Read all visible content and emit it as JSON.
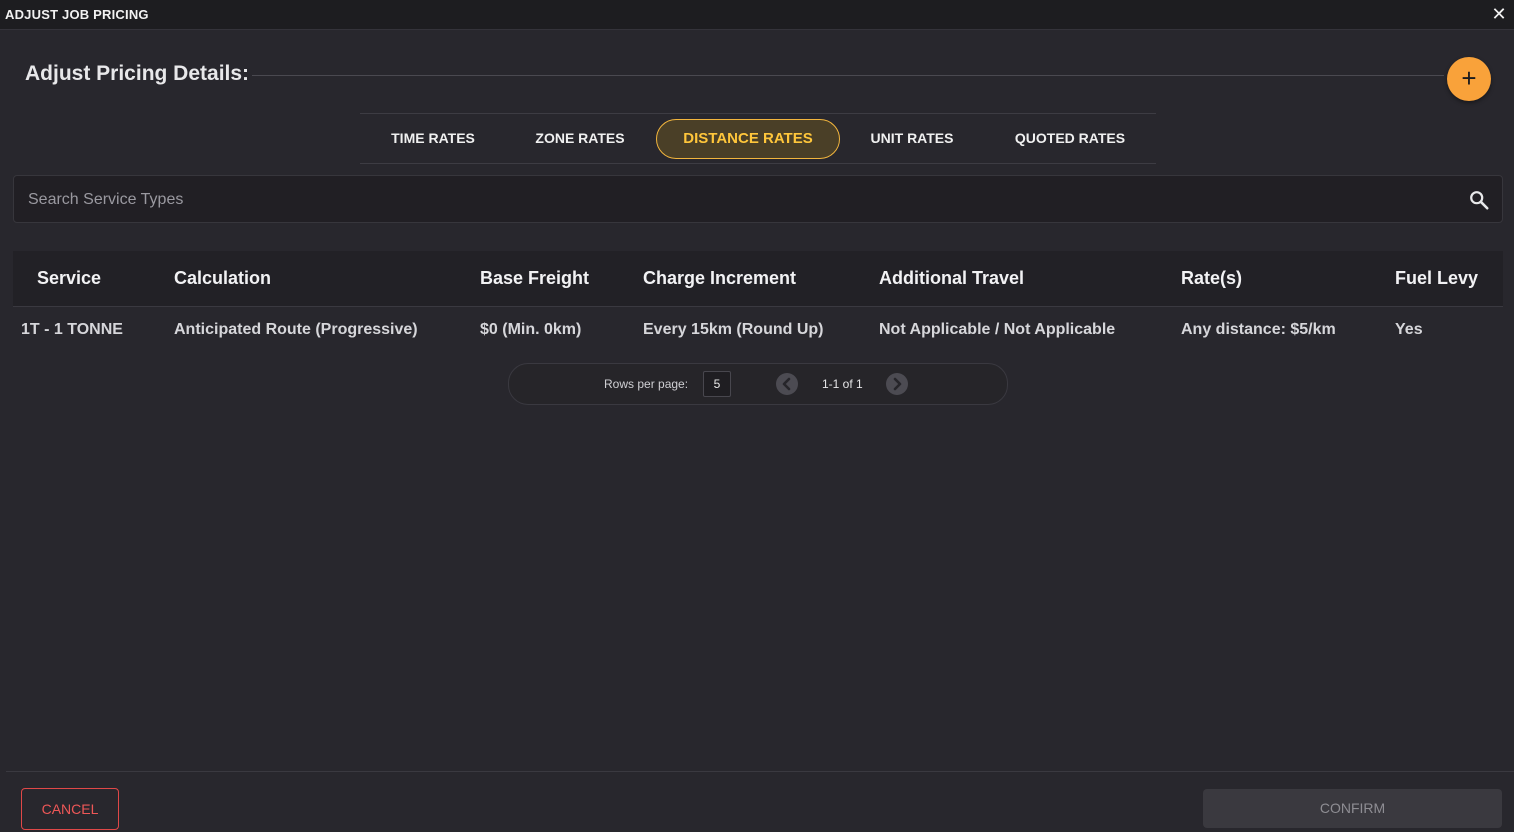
{
  "dialog": {
    "title": "ADJUST JOB PRICING",
    "close_glyph": "✕"
  },
  "section": {
    "heading": "Adjust Pricing Details:",
    "add_glyph": "+"
  },
  "tabs": [
    {
      "label": "TIME RATES",
      "active": false
    },
    {
      "label": "ZONE RATES",
      "active": false
    },
    {
      "label": "DISTANCE RATES",
      "active": true
    },
    {
      "label": "UNIT RATES",
      "active": false
    },
    {
      "label": "QUOTED RATES",
      "active": false
    }
  ],
  "search": {
    "placeholder": "Search Service Types",
    "icon": "search-icon"
  },
  "table": {
    "headers": [
      "Service",
      "Calculation",
      "Base Freight",
      "Charge Increment",
      "Additional Travel",
      "Rate(s)",
      "Fuel Levy"
    ],
    "rows": [
      [
        "1T - 1 TONNE",
        "Anticipated Route (Progressive)",
        "$0 (Min. 0km)",
        "Every 15km (Round Up)",
        "Not Applicable / Not Applicable",
        "Any distance: $5/km",
        "Yes"
      ]
    ]
  },
  "pagination": {
    "rows_per_page_label": "Rows per page:",
    "rows_per_page": "5",
    "range": "1-1 of 1"
  },
  "footer": {
    "cancel_label": "CANCEL",
    "confirm_label": "CONFIRM"
  },
  "colors": {
    "accent": "#f9a23a",
    "active_tab": "#ffc63b",
    "danger": "#e04848",
    "background": "#28272d"
  }
}
